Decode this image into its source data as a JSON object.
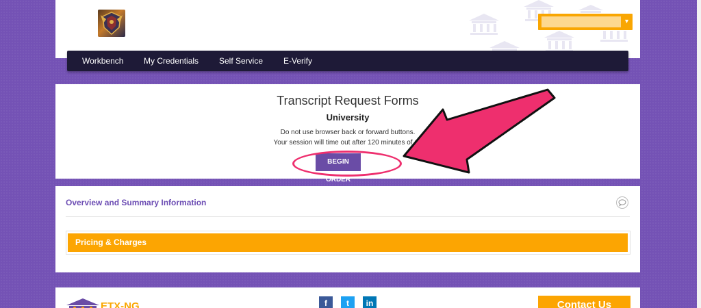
{
  "colors": {
    "page_bg": "#7452b5",
    "nav_bg": "#1e1a37",
    "accent_orange": "#fca502",
    "button_purple": "#6a4ca6",
    "annotation_pink": "#ee2f6e",
    "link_purple": "#6d4eb4"
  },
  "header": {
    "logo_icon": "university-crest-icon",
    "language_select": {
      "value": "",
      "caret": "▾"
    }
  },
  "nav": {
    "items": [
      {
        "label": "Workbench"
      },
      {
        "label": "My Credentials"
      },
      {
        "label": "Self Service"
      },
      {
        "label": "E-Verify"
      }
    ]
  },
  "main": {
    "title": "Transcript Request Forms",
    "subtitle": "University",
    "notes": [
      "Do not use browser back or forward buttons.",
      "Your session will time out after 120 minutes of no"
    ],
    "begin_button": "BEGIN ORDER"
  },
  "overview": {
    "title": "Overview and Summary Information",
    "chat_icon": "chat-bubble-icon",
    "pricing_label": "Pricing & Charges"
  },
  "footer": {
    "logo_text": "ETX-NG",
    "social": [
      {
        "label": "f",
        "icon": "facebook-icon",
        "color": "#3b5998"
      },
      {
        "label": "t",
        "icon": "twitter-icon",
        "color": "#1da1f2"
      },
      {
        "label": "in",
        "icon": "linkedin-icon",
        "color": "#0077b5"
      }
    ],
    "contact_button": "Contact Us"
  }
}
